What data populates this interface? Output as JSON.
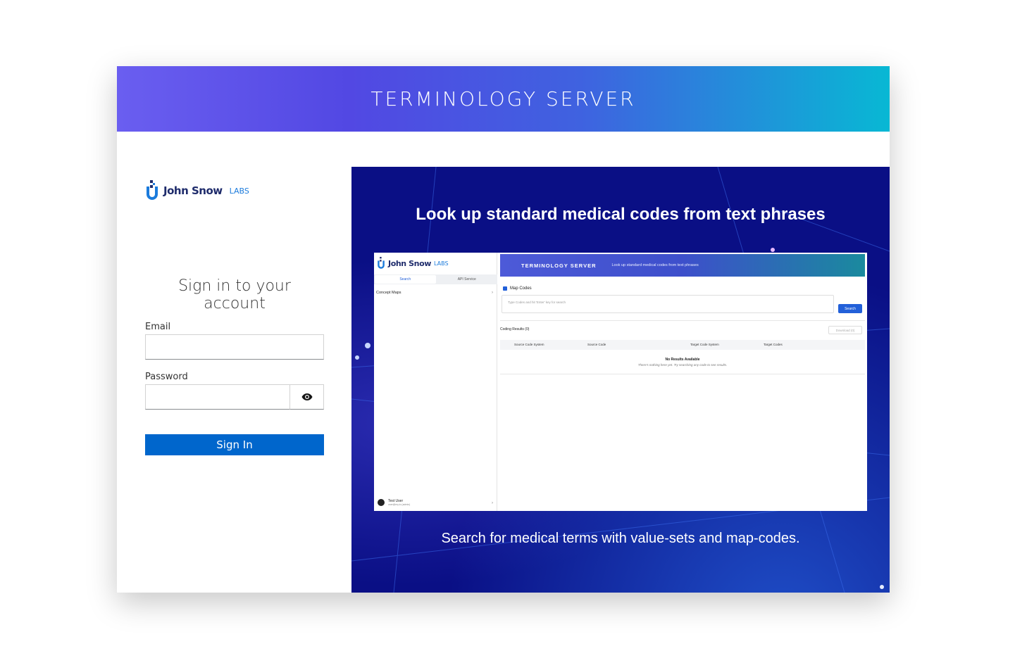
{
  "banner": {
    "title": "TERMINOLOGY SERVER"
  },
  "brand": {
    "name": "John Snow",
    "suffix": "LABS"
  },
  "login": {
    "heading": "Sign in to your account",
    "email_label": "Email",
    "email_value": "",
    "password_label": "Password",
    "password_value": "",
    "submit_label": "Sign In"
  },
  "promo": {
    "title": "Look up standard medical codes from text phrases",
    "subtitle": "Search for medical terms with value-sets and map-codes.",
    "preview": {
      "brand_name": "John Snow",
      "brand_suffix": "LABS",
      "tabs": [
        "Search",
        "API Service"
      ],
      "concept_maps": "Concept Maps",
      "banner_title": "TERMINOLOGY SERVER",
      "banner_tagline": "Look up standard medical codes from text phrases",
      "map_codes": "Map Codes",
      "input_placeholder": "Type Codes and hit 'Enter' key for search",
      "search_button": "Search",
      "results_label": "Coding Results (0)",
      "download_button": "Download (0)",
      "columns": [
        "Source Code System",
        "Source Code",
        "Target Code System",
        "Target Codes"
      ],
      "empty_title": "No Results Available",
      "empty_subtitle": "There's nothing here yet. Try searching any code to see results.",
      "user_name": "Test User",
      "user_sub": "user@my.io (admin)"
    }
  },
  "colors": {
    "primary_button": "#0066cc",
    "banner_start": "#6a5ef0",
    "banner_end": "#08b8d4",
    "promo_bg": "#0a0f85"
  },
  "icons": {
    "password_toggle": "eye-icon",
    "logo": "john-snow-labs-logo"
  }
}
